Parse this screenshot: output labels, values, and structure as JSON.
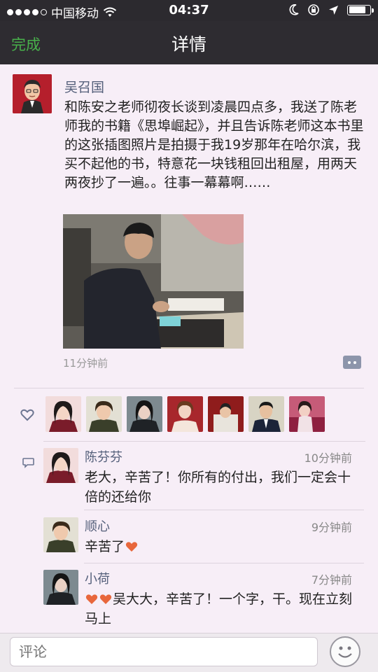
{
  "status_bar": {
    "carrier": "中国移动",
    "time": "04:37",
    "battery_level": 0.85
  },
  "nav": {
    "done_label": "完成",
    "title": "详情"
  },
  "post": {
    "author": "吴召国",
    "text": "和陈安之老师彻夜长谈到凌晨四点多，我送了陈老师我的书籍《思埠崛起》，并且告诉陈老师这本书里的这张插图照片是拍摄于我19岁那年在哈尔滨，我买不起他的书，特意花一块钱租回出租屋，用两天两夜抄了一遍。。往事一幕幕啊……",
    "time": "11分钟前"
  },
  "comments": [
    {
      "name": "陈芬芬",
      "time": "10分钟前",
      "text": "老大，辛苦了！你所有的付出，我们一定会十倍的还给你"
    },
    {
      "name": "顺心",
      "time": "9分钟前",
      "text_before": "辛苦了",
      "text_after": ""
    },
    {
      "name": "小荷",
      "time": "7分钟前",
      "text_after": "吴大大，辛苦了！一个字，干。现在立刻马上"
    }
  ],
  "input": {
    "placeholder": "评论"
  },
  "icons": {
    "like": "heart-icon",
    "comment": "comment-bubble-icon",
    "emoji": "smiley-face-icon",
    "action": "comment-action-icon"
  }
}
